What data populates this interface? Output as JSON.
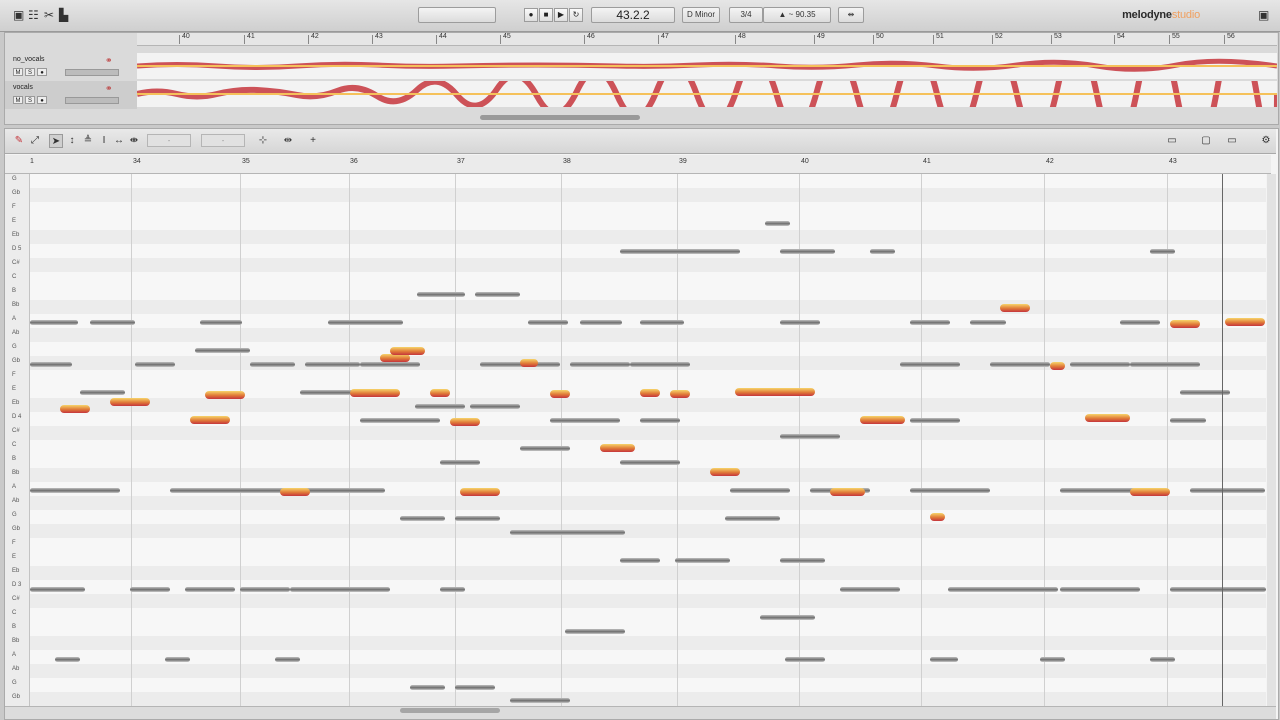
{
  "toolbar": {
    "position": "43.2.2",
    "key": "D Minor",
    "meter": "3/4",
    "tempo": "90.35",
    "brand": "melodyne",
    "edition": "studio"
  },
  "overview": {
    "bars": [
      "40",
      "41",
      "42",
      "43",
      "44",
      "45",
      "46",
      "47",
      "48",
      "49",
      "50",
      "51",
      "52",
      "53",
      "54",
      "55",
      "56"
    ],
    "tracks": [
      {
        "name": "no_vocals",
        "mute": "M",
        "solo": "S"
      },
      {
        "name": "vocals",
        "mute": "M",
        "solo": "S"
      }
    ]
  },
  "editor": {
    "field_a": "-",
    "field_b": "-",
    "bars": [
      "1",
      "34",
      "35",
      "36",
      "37",
      "38",
      "39",
      "40",
      "41",
      "42",
      "43"
    ],
    "pitches": [
      "G",
      "Gb",
      "F",
      "E",
      "Eb",
      "D 5",
      "C#",
      "C",
      "B",
      "Bb",
      "A",
      "Ab",
      "G",
      "Gb",
      "F",
      "E",
      "Eb",
      "D 4",
      "C#",
      "C",
      "B",
      "Bb",
      "A",
      "Ab",
      "G",
      "Gb",
      "F",
      "E",
      "Eb",
      "D 3",
      "C#",
      "C",
      "B",
      "Bb",
      "A",
      "Ab",
      "G",
      "Gb"
    ]
  },
  "colors": {
    "accent": "#e07a38",
    "blob_hot": "#c5353c",
    "blob": "#7a7a7a",
    "brand_accent": "#f0a060"
  }
}
